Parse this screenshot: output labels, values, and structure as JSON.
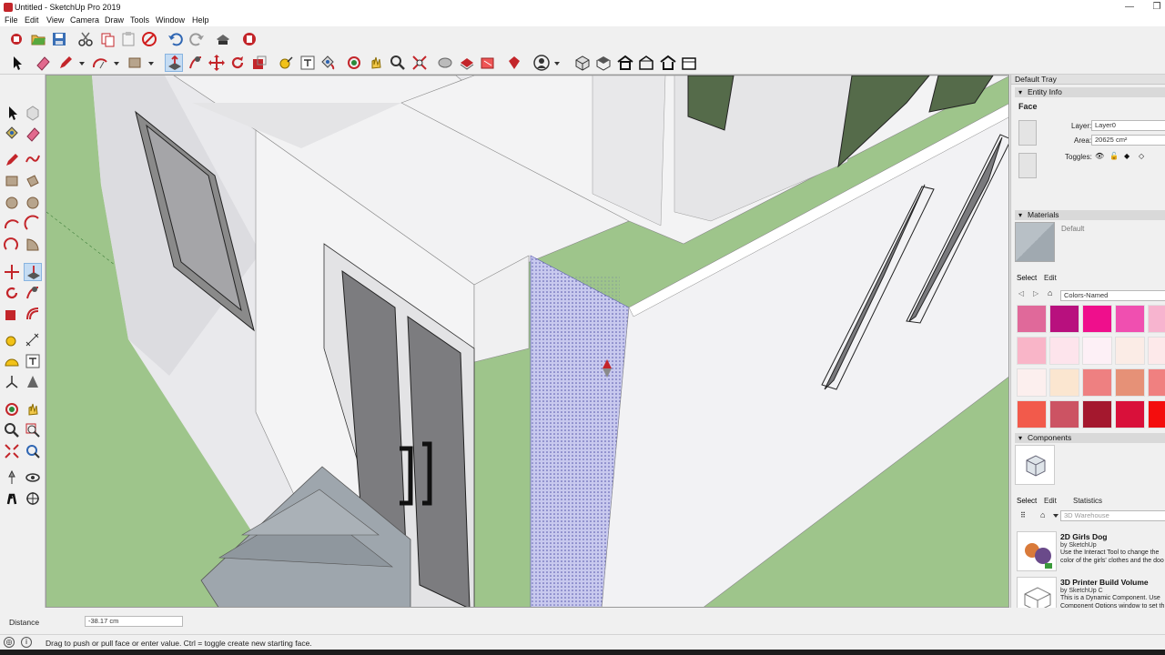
{
  "window": {
    "title": "Untitled - SketchUp Pro 2019",
    "minimize": "—",
    "restore": "❐"
  },
  "menu": [
    "File",
    "Edit",
    "View",
    "Camera",
    "Draw",
    "Tools",
    "Window",
    "Help"
  ],
  "toolbar_icons": {
    "row1": [
      "3d-warehouse-icon",
      "open-icon",
      "save-icon",
      "cut-icon",
      "copy-icon",
      "paste-icon",
      "erase-icon",
      "undo-icon",
      "redo-icon",
      "print-icon",
      "model-info-icon"
    ],
    "row2": [
      "select-icon",
      "eraser-icon",
      "pencil-icon",
      "arc-icon",
      "rectangle-icon",
      "push-pull-icon",
      "follow-me-icon",
      "move-icon",
      "rotate-icon",
      "scale-icon",
      "tape-measure-icon",
      "text-icon",
      "paint-bucket-icon",
      "orbit-icon",
      "pan-icon",
      "zoom-icon",
      "zoom-extents-icon",
      "section-plane-icon",
      "warehouse-share-icon",
      "extension-warehouse-icon",
      "ruby-icon",
      "account-icon",
      "iso-view-icon",
      "top-view-icon",
      "front-view-icon",
      "right-view-icon",
      "back-view-icon"
    ]
  },
  "tray": {
    "title": "Default Tray",
    "entity_info": {
      "title": "Entity Info",
      "type": "Face",
      "layer_label": "Layer:",
      "layer_value": "Layer0",
      "area_label": "Area:",
      "area_value": "20625 cm²",
      "toggles_label": "Toggles:"
    },
    "materials": {
      "title": "Materials",
      "current": "Default",
      "tabs": [
        "Select",
        "Edit"
      ],
      "library": "Colors-Named",
      "swatches": [
        "#e0699a",
        "#b8107e",
        "#ef0f8c",
        "#f04fb0",
        "#f7b4cf",
        "#f9b5c8",
        "#fde4ec",
        "#fdf0f6",
        "#fbece6",
        "#fde9ea",
        "#fcefee",
        "#fbe6d0",
        "#ee8081",
        "#e69177",
        "#f08080",
        "#f25a4b",
        "#cc5363",
        "#a4182e",
        "#d9103a",
        "#f40d0d"
      ]
    },
    "components": {
      "title": "Components",
      "tabs": [
        "Select",
        "Edit",
        "Statistics"
      ],
      "search_placeholder": "3D Warehouse",
      "items": [
        {
          "name": "2D Girls Dog",
          "by": "by SketchUp",
          "desc": "Use the Interact Tool to change the color of the girls' clothes and the doo"
        },
        {
          "name": "3D Printer Build Volume",
          "by": "by SketchUp C",
          "desc": "This is a Dynamic Component. Use Component Options window to set th"
        }
      ]
    }
  },
  "status": {
    "measure_label": "Distance",
    "measure_value": "-38.17 cm",
    "hint": "Drag to push or pull face or enter value.  Ctrl = toggle create new starting face."
  }
}
